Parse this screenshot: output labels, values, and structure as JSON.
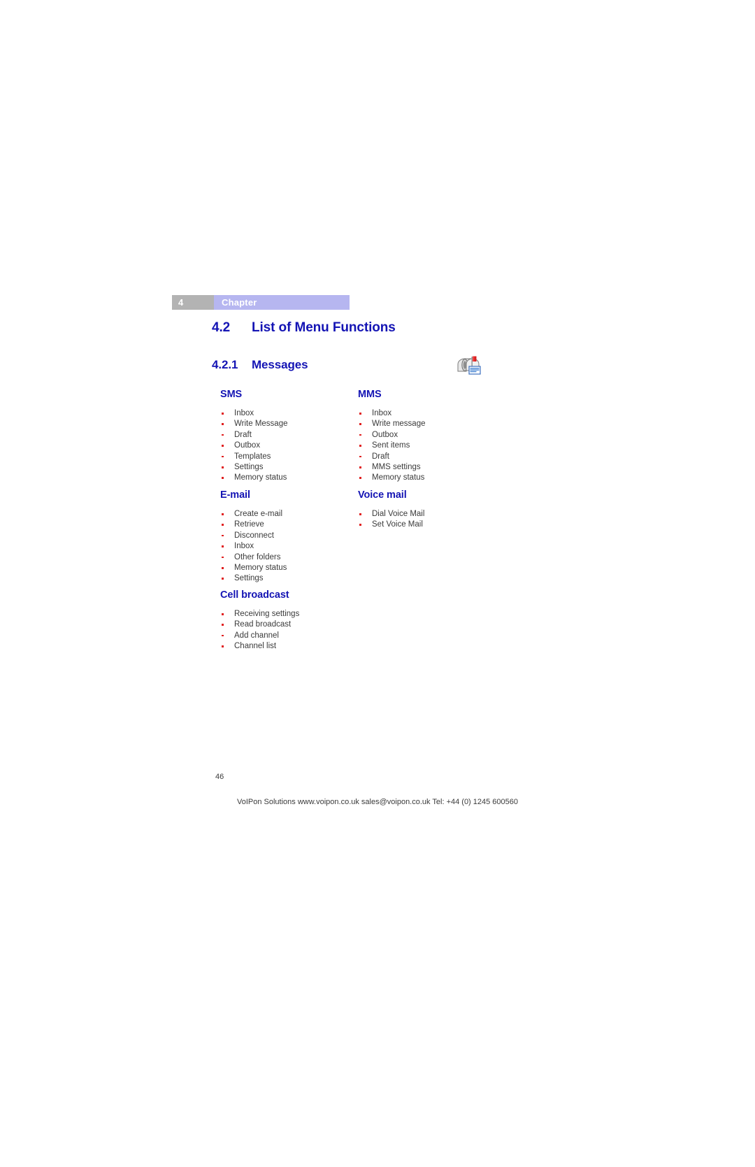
{
  "header": {
    "chapter_number": "4",
    "chapter_label": "Chapter"
  },
  "sections": {
    "h2_number": "4.2",
    "h2_title": "List of Menu Functions",
    "h3_number": "4.2.1",
    "h3_title": "Messages"
  },
  "icons": {
    "messages_icon": "mailbox-with-letter-icon"
  },
  "colors": {
    "heading_blue": "#1414b4",
    "bullet_red": "#e02020",
    "chapter_band": "#b6b6f0",
    "chapter_num_box": "#b3b3b3",
    "body_text": "#3a3a3a"
  },
  "menu_groups": [
    {
      "heading": "SMS",
      "column": "left",
      "items": [
        "Inbox",
        "Write Message",
        "Draft",
        "Outbox",
        "Templates",
        "Settings",
        "Memory status"
      ]
    },
    {
      "heading": "MMS",
      "column": "right",
      "items": [
        "Inbox",
        "Write message",
        "Outbox",
        "Sent items",
        "Draft",
        "MMS settings",
        "Memory status"
      ]
    },
    {
      "heading": "E-mail",
      "column": "left",
      "items": [
        "Create e-mail",
        "Retrieve",
        "Disconnect",
        "Inbox",
        "Other folders",
        "Memory status",
        "Settings"
      ]
    },
    {
      "heading": "Voice mail",
      "column": "right",
      "items": [
        "Dial Voice Mail",
        "Set Voice Mail"
      ]
    },
    {
      "heading": "Cell broadcast",
      "column": "left",
      "items": [
        "Receiving settings",
        "Read broadcast",
        "Add channel",
        "Channel list"
      ]
    }
  ],
  "footer": {
    "page_number": "46",
    "contact_line": "VoIPon Solutions  www.voipon.co.uk  sales@voipon.co.uk  Tel: +44 (0) 1245 600560"
  }
}
